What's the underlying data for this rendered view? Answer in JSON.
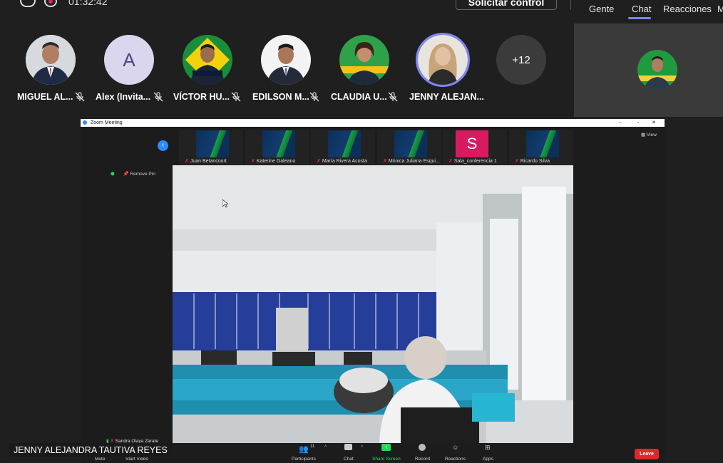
{
  "top": {
    "timer": "01:32:42",
    "request_control": "Solicitar control",
    "tabs": [
      "Gente",
      "Chat",
      "Reacciones",
      "M"
    ],
    "active_tab": "Chat"
  },
  "participants": [
    {
      "name": "MIGUEL AL...",
      "avatar": "photo"
    },
    {
      "name": "Alex (Invita...",
      "avatar": "initial",
      "initial": "A"
    },
    {
      "name": "VÍCTOR HU...",
      "avatar": "photo"
    },
    {
      "name": "EDILSON M...",
      "avatar": "photo"
    },
    {
      "name": "CLAUDIA U...",
      "avatar": "photo"
    },
    {
      "name": "JENNY ALEJAN...",
      "avatar": "photo"
    }
  ],
  "more_participants": "+12",
  "zoom": {
    "window_title": "Zoom Meeting",
    "view_label": "View",
    "remove_pin": "Remove Pin",
    "thumbnails": [
      "Juan Betancourt",
      "Katerine Galeano",
      "María Rivera Acosta",
      "Mónica Juliana Esqui...",
      "Sala_conferencia 1",
      "Ricardo Silva"
    ],
    "sala_initial": "S",
    "speaker_name": "Sandra Olaya Zarate",
    "toolbar": {
      "mute": "Mute",
      "start_video": "Start Video",
      "participants": "Participants",
      "participants_count": "11",
      "chat": "Chat",
      "share_screen": "Share Screen",
      "record": "Record",
      "reactions": "Reactions",
      "apps": "Apps",
      "leave": "Leave"
    }
  },
  "caption": "JENNY ALEJANDRA TAUTIVA REYES",
  "colors": {
    "accent": "#7f85f5",
    "leave": "#e02828",
    "share": "#23d959",
    "sala": "#d81b60"
  }
}
